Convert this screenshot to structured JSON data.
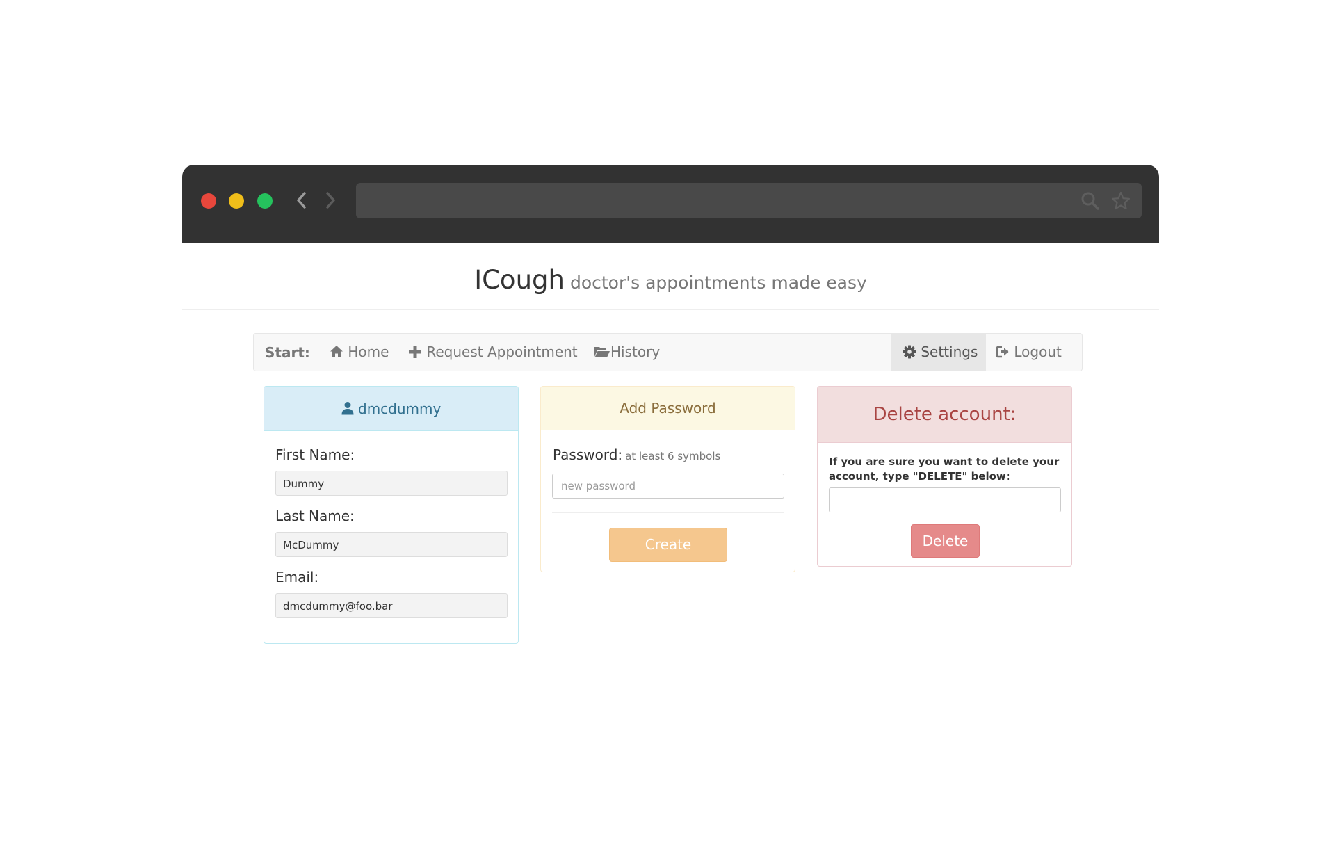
{
  "header": {
    "title": "ICough",
    "subtitle": "doctor's appointments made easy"
  },
  "navbar": {
    "brand": "Start:",
    "items": [
      {
        "label": "Home",
        "icon": "home-icon"
      },
      {
        "label": "Request Appointment",
        "icon": "plus-icon"
      },
      {
        "label": "History",
        "icon": "folder-open-icon"
      }
    ],
    "right_items": [
      {
        "label": "Settings",
        "icon": "gear-icon",
        "active": true
      },
      {
        "label": "Logout",
        "icon": "logout-icon"
      }
    ]
  },
  "profile": {
    "username": "dmcdummy",
    "first_name_label": "First Name:",
    "first_name": "Dummy",
    "last_name_label": "Last Name:",
    "last_name": "McDummy",
    "email_label": "Email:",
    "email": "dmcdummy@foo.bar"
  },
  "password": {
    "heading": "Add Password",
    "label": "Password:",
    "hint": "at least 6 symbols",
    "placeholder": "new password",
    "button": "Create"
  },
  "delete": {
    "heading": "Delete account:",
    "instruction": "If you are sure you want to delete your account, type \"DELETE\" below:",
    "button": "Delete"
  },
  "colors": {
    "info_bg": "#d9edf7",
    "warning_bg": "#fcf8e3",
    "danger_bg": "#f2dede",
    "create_button": "#f5c78e",
    "delete_button": "#e58a8a"
  }
}
